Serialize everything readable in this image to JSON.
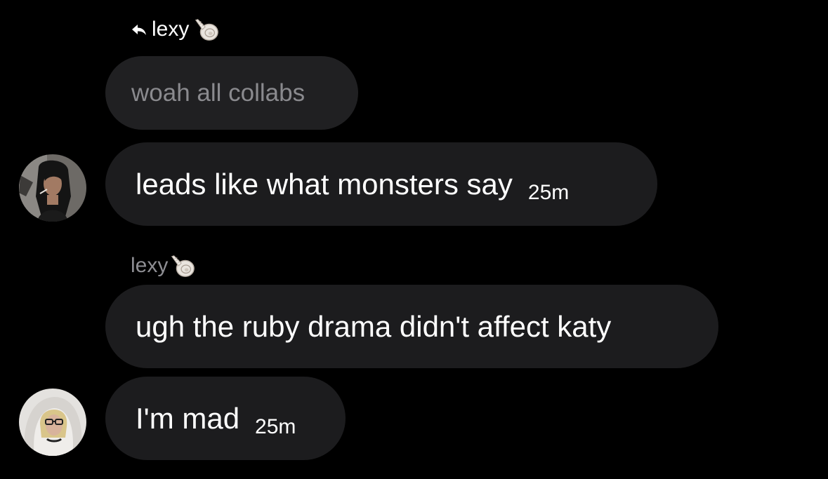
{
  "reply": {
    "sender": "lexy",
    "quoted_text": "woah all collabs"
  },
  "messages": [
    {
      "text": "leads like what monsters say",
      "time": "25m",
      "avatar": "avatar-dark-hair-person"
    },
    {
      "text": "ugh the ruby drama didn't affect katy",
      "sender": "lexy"
    },
    {
      "text": "I'm mad",
      "time": "25m",
      "avatar": "avatar-blonde-hoodie-person"
    }
  ],
  "icons": {
    "reply": "reply-arrow-icon",
    "shell": "spiral-shell-emoji"
  },
  "colors": {
    "background": "#000000",
    "bubble": "#1c1c1e",
    "quoted_text": "#8a8a8e",
    "sender_label": "#8e8e93"
  }
}
